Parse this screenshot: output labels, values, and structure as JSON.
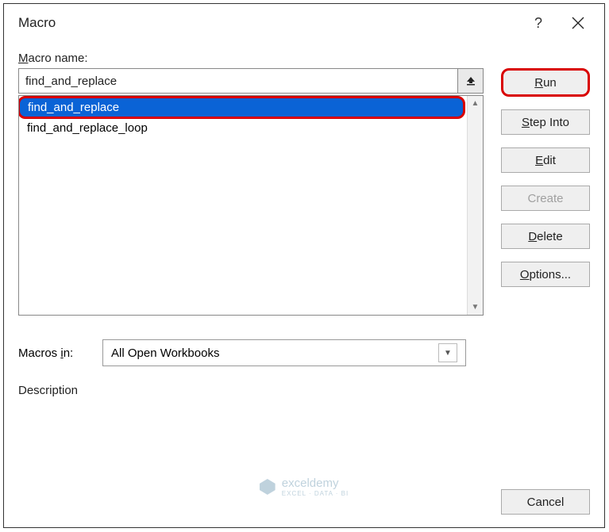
{
  "title": "Macro",
  "help_char": "?",
  "labels": {
    "macro_name_prefix": "M",
    "macro_name_rest": "acro name:",
    "macros_in_prefix": "Macros ",
    "macros_in_underline": "i",
    "macros_in_rest": "n:",
    "description": "Description"
  },
  "name_input_value": "find_and_replace",
  "macro_list": [
    {
      "name": "find_and_replace",
      "selected": true
    },
    {
      "name": "find_and_replace_loop",
      "selected": false
    }
  ],
  "dropdown_value": "All Open Workbooks",
  "buttons": {
    "run_u": "R",
    "run_rest": "un",
    "step_u": "S",
    "step_rest": "tep Into",
    "edit_u": "E",
    "edit_rest": "dit",
    "create": "Create",
    "delete_u": "D",
    "delete_rest": "elete",
    "options_u": "O",
    "options_rest": "ptions...",
    "cancel": "Cancel"
  },
  "watermark": {
    "name": "exceldemy",
    "sub": "EXCEL · DATA · BI"
  }
}
